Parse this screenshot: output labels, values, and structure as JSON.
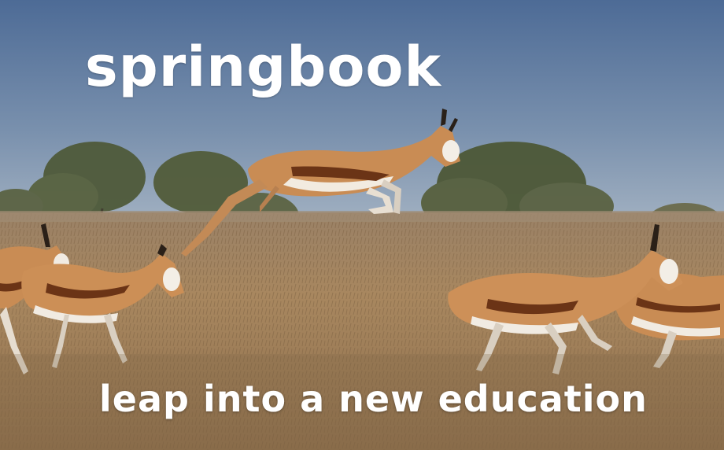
{
  "title": "springbook",
  "tagline": "leap into a new education",
  "colors": {
    "sky_top": "#4f6d98",
    "sky_bottom": "#9bb0c6",
    "grass": "#a88760",
    "text": "#ffffff"
  }
}
